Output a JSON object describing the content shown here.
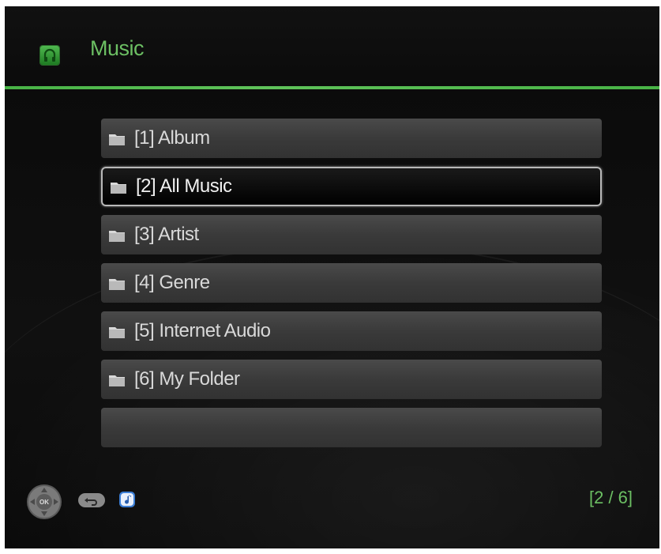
{
  "header": {
    "title": "Music",
    "icon": "music-app-icon",
    "accent_color": "#5fc35a"
  },
  "menu": {
    "items": [
      {
        "label": "[1] Album",
        "icon": "folder-icon"
      },
      {
        "label": "[2] All Music",
        "icon": "folder-icon",
        "selected": true
      },
      {
        "label": "[3] Artist",
        "icon": "folder-icon"
      },
      {
        "label": "[4] Genre",
        "icon": "folder-icon"
      },
      {
        "label": "[5] Internet Audio",
        "icon": "folder-icon"
      },
      {
        "label": "[6] My Folder",
        "icon": "folder-icon"
      },
      {
        "label": ""
      }
    ]
  },
  "footer": {
    "icons": [
      "dpad-ok-icon",
      "return-icon",
      "music-note-icon"
    ],
    "page_indicator": "[2 / 6]"
  }
}
